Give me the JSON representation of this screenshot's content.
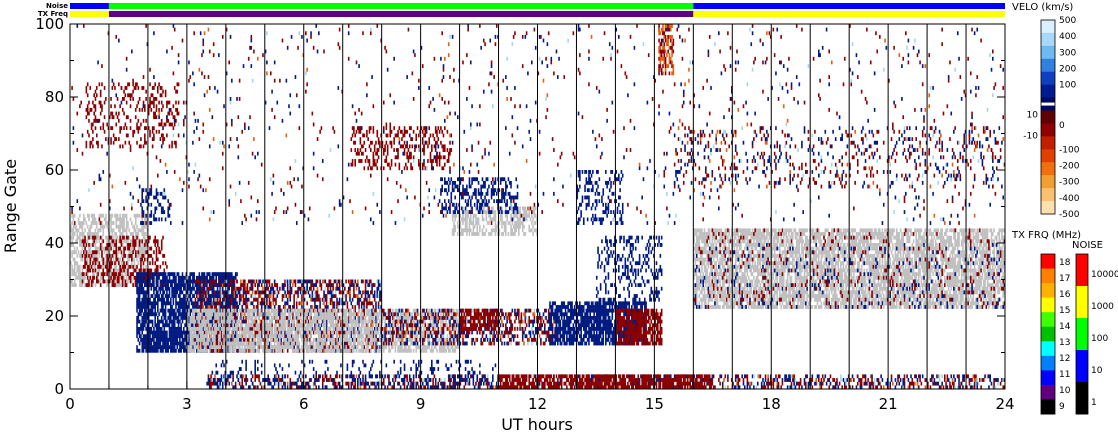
{
  "strip_labels": {
    "noise": "Noise",
    "tx_freq": "TX Freq"
  },
  "chart_data": {
    "type": "heatmap",
    "xlabel": "UT hours",
    "ylabel": "Range Gate",
    "xlim": [
      0,
      24
    ],
    "ylim": [
      0,
      100
    ],
    "xticks": [
      0,
      3,
      6,
      9,
      12,
      15,
      18,
      21,
      24
    ],
    "yticks": [
      0,
      20,
      40,
      60,
      80,
      100
    ],
    "hour_lines": [
      1,
      2,
      3,
      4,
      5,
      6,
      7,
      8,
      9,
      10,
      11,
      12,
      13,
      14,
      15,
      16,
      17,
      18,
      19,
      20,
      21,
      22,
      23
    ],
    "grid": false,
    "colors": {
      "ground_scatter": "#c0c0c0",
      "toward": "#001a80",
      "away": "#8b0000",
      "strong_away": "#e06010",
      "light": "#a0d8f0"
    },
    "velocity_scale": {
      "title": "VELO (km/s)",
      "ticks": [
        "500",
        "400",
        "300",
        "200",
        "100",
        "10",
        "0",
        "-10",
        "-100",
        "-200",
        "-300",
        "-400",
        "-500"
      ],
      "colors": [
        "#d8f0ff",
        "#a8d8f8",
        "#70b8f0",
        "#3080e0",
        "#1040c0",
        "#001a90",
        "#000a60",
        "#600000",
        "#900000",
        "#c02000",
        "#e04000",
        "#f07010",
        "#f0a030",
        "#f8c070",
        "#fce0b0"
      ]
    },
    "tx_freq_scale": {
      "title": "TX FRQ (MHz)",
      "ticks": [
        "18",
        "17",
        "16",
        "15",
        "14",
        "13",
        "12",
        "11",
        "10",
        "9"
      ],
      "colors": [
        "#ff0000",
        "#ff8000",
        "#ffb000",
        "#ffff00",
        "#40ff00",
        "#00c000",
        "#00ffff",
        "#0080ff",
        "#0000ff",
        "#600080",
        "#000000"
      ]
    },
    "noise_scale": {
      "title": "NOISE",
      "ticks": [
        "10000",
        "1000",
        "100",
        "10",
        "1"
      ],
      "colors": [
        "#ff0000",
        "#ffff00",
        "#00ff00",
        "#0000ff",
        "#000000"
      ]
    },
    "regions": [
      {
        "type": "ground",
        "x": [
          0.0,
          2.0
        ],
        "g": [
          28,
          48
        ],
        "d": 0.55
      },
      {
        "type": "away",
        "x": [
          0.3,
          2.5
        ],
        "g": [
          28,
          42
        ],
        "d": 0.35
      },
      {
        "type": "away",
        "x": [
          0.4,
          2.8
        ],
        "g": [
          66,
          84
        ],
        "d": 0.22
      },
      {
        "type": "toward",
        "x": [
          1.8,
          2.6
        ],
        "g": [
          45,
          55
        ],
        "d": 0.3
      },
      {
        "type": "toward",
        "x": [
          1.7,
          4.3
        ],
        "g": [
          10,
          32
        ],
        "d": 0.75
      },
      {
        "type": "mixed",
        "x": [
          3.2,
          8.0
        ],
        "g": [
          10,
          30
        ],
        "d": 0.55
      },
      {
        "type": "ground",
        "x": [
          3.0,
          10.0
        ],
        "g": [
          10,
          22
        ],
        "d": 0.6
      },
      {
        "type": "mixed",
        "x": [
          8.0,
          12.5
        ],
        "g": [
          12,
          22
        ],
        "d": 0.45
      },
      {
        "type": "away",
        "x": [
          7.2,
          9.8
        ],
        "g": [
          60,
          72
        ],
        "d": 0.3
      },
      {
        "type": "ground",
        "x": [
          9.8,
          12.0
        ],
        "g": [
          42,
          50
        ],
        "d": 0.5
      },
      {
        "type": "toward",
        "x": [
          9.5,
          11.5
        ],
        "g": [
          48,
          58
        ],
        "d": 0.35
      },
      {
        "type": "away",
        "x": [
          10.0,
          11.0
        ],
        "g": [
          16,
          22
        ],
        "d": 0.65
      },
      {
        "type": "toward",
        "x": [
          12.3,
          14.8
        ],
        "g": [
          12,
          24
        ],
        "d": 0.75
      },
      {
        "type": "away",
        "x": [
          14.0,
          15.2
        ],
        "g": [
          12,
          22
        ],
        "d": 0.75
      },
      {
        "type": "toward",
        "x": [
          13.5,
          15.2
        ],
        "g": [
          24,
          42
        ],
        "d": 0.28
      },
      {
        "type": "toward",
        "x": [
          13.0,
          14.2
        ],
        "g": [
          45,
          60
        ],
        "d": 0.25
      },
      {
        "type": "ground",
        "x": [
          16.0,
          24.0
        ],
        "g": [
          22,
          44
        ],
        "d": 0.72
      },
      {
        "type": "toward",
        "x": [
          16.0,
          24.0
        ],
        "g": [
          22,
          40
        ],
        "d": 0.06
      },
      {
        "type": "away",
        "x": [
          16.0,
          24.0
        ],
        "g": [
          22,
          44
        ],
        "d": 0.05
      },
      {
        "type": "mixed",
        "x": [
          3.5,
          24.0
        ],
        "g": [
          0,
          4
        ],
        "d": 0.4
      },
      {
        "type": "away",
        "x": [
          11.0,
          16.5
        ],
        "g": [
          0,
          4
        ],
        "d": 0.65
      },
      {
        "type": "toward",
        "x": [
          3.5,
          11.0
        ],
        "g": [
          0,
          8
        ],
        "d": 0.15
      },
      {
        "type": "mixed",
        "x": [
          15.5,
          24.0
        ],
        "g": [
          55,
          72
        ],
        "d": 0.12
      },
      {
        "type": "strong",
        "x": [
          15.1,
          15.5
        ],
        "g": [
          86,
          100
        ],
        "d": 0.55
      },
      {
        "type": "mixed",
        "x": [
          0.0,
          24.0
        ],
        "g": [
          45,
          100
        ],
        "d": 0.025
      }
    ],
    "noise_strip": [
      {
        "x": [
          0.0,
          1.0
        ],
        "c": "#0000ff"
      },
      {
        "x": [
          1.0,
          16.0
        ],
        "c": "#00ff00"
      },
      {
        "x": [
          16.0,
          24.0
        ],
        "c": "#0000ff"
      }
    ],
    "freq_strip": [
      {
        "x": [
          0.0,
          1.0
        ],
        "c": "#ffff00"
      },
      {
        "x": [
          1.0,
          16.0
        ],
        "c": "#600080"
      },
      {
        "x": [
          16.0,
          24.0
        ],
        "c": "#ffff00"
      }
    ]
  }
}
